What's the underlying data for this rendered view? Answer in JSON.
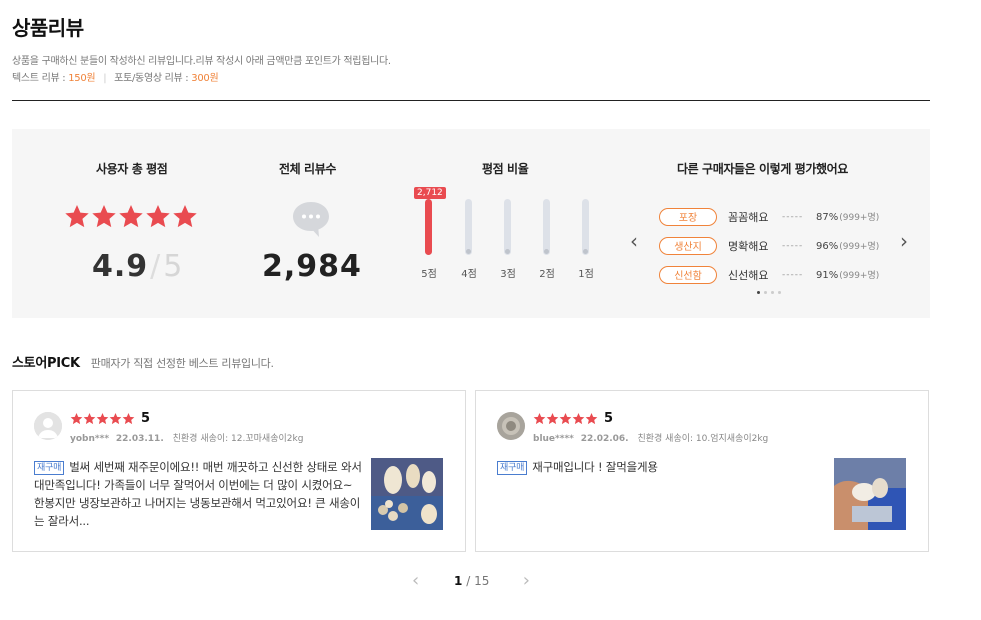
{
  "header": {
    "title": "상품리뷰",
    "description": "상품을 구매하신 분들이 작성하신 리뷰입니다.리뷰 작성시 아래 금액만큼 포인트가 적립됩니다.",
    "text_review_label": "텍스트 리뷰 :",
    "text_review_point": "150원",
    "photo_review_label": "포토/동영상 리뷰 :",
    "photo_review_point": "300원"
  },
  "summary": {
    "rating_title": "사용자 총 평점",
    "rating": "4.9",
    "rating_max": "5",
    "rating_stars": 5,
    "count_title": "전체 리뷰수",
    "count": "2,984",
    "ratio_title": "평점 비율",
    "ratio_bars": [
      {
        "label": "5점",
        "fraction": 1.0,
        "count": "2,712"
      },
      {
        "label": "4점",
        "fraction": 0.0
      },
      {
        "label": "3점",
        "fraction": 0.0
      },
      {
        "label": "2점",
        "fraction": 0.0
      },
      {
        "label": "1점",
        "fraction": 0.0
      }
    ],
    "eval_title": "다른 구매자들은 이렇게 평가했어요",
    "evaluations": [
      {
        "tag": "포장",
        "text": "꼼꼼해요",
        "dash": "-----",
        "pct": "87%",
        "cnt": "(999+명)"
      },
      {
        "tag": "생산지",
        "text": "명확해요",
        "dash": "-----",
        "pct": "96%",
        "cnt": "(999+명)"
      },
      {
        "tag": "신선함",
        "text": "신선해요",
        "dash": "-----",
        "pct": "91%",
        "cnt": "(999+명)"
      }
    ]
  },
  "store_pick": {
    "title": "스토어PICK",
    "desc": "판매자가 직접 선정한 베스트 리뷰입니다."
  },
  "reviews": [
    {
      "rating": "5",
      "user": "yobn***",
      "date": "22.03.11.",
      "option": "친환경 새송이: 12.꼬마새송이2kg",
      "badge": "재구매",
      "body": "벌써 세번째 재주문이에요!! 매번 깨끗하고 신선한 상태로 와서 대만족입니다! 가족들이 너무 잘먹어서 이번에는 더 많이 시켰어요~ 한봉지만 냉장보관하고 나머지는 냉동보관해서 먹고있어요! 큰 새송이는 잘라서..."
    },
    {
      "rating": "5",
      "user": "blue****",
      "date": "22.02.06.",
      "option": "친환경 새송이: 10.엄지새송이2kg",
      "badge": "재구매",
      "body": "재구매입니다 ! 잘먹을게용"
    }
  ],
  "pagination": {
    "current": "1",
    "sep": "/",
    "total": "15"
  },
  "colors": {
    "accent": "#f0833a",
    "star": "#e94b50",
    "rebuy": "#4a7dcf"
  }
}
